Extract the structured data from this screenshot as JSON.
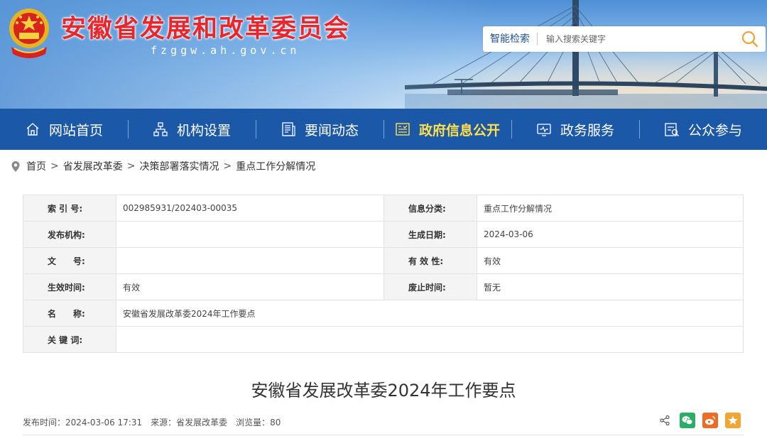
{
  "header": {
    "site_title": "安徽省发展和改革委员会",
    "site_domain": "fzggw.ah.gov.cn",
    "search": {
      "label": "智能检索",
      "placeholder": "输入搜索关键字"
    }
  },
  "nav": {
    "items": [
      {
        "label": "网站首页",
        "icon": "home-icon"
      },
      {
        "label": "机构设置",
        "icon": "org-chart-icon"
      },
      {
        "label": "要闻动态",
        "icon": "news-icon"
      },
      {
        "label": "政府信息公开",
        "icon": "info-disclosure-icon",
        "active": true
      },
      {
        "label": "政务服务",
        "icon": "service-monitor-icon"
      },
      {
        "label": "公众参与",
        "icon": "participation-icon"
      }
    ],
    "active_color": "#ffe04a",
    "bar_color": "#1c58a8"
  },
  "breadcrumb": {
    "icon": "location-pin-icon",
    "separator": ">",
    "items": [
      "首页",
      "省发展改革委",
      "决策部署落实情况",
      "重点工作分解情况"
    ]
  },
  "info": {
    "index_no_label": "索 引 号:",
    "index_no": "002985931/202403-00035",
    "category_label": "信息分类:",
    "category": "重点工作分解情况",
    "publisher_label": "发布机构:",
    "publisher": "",
    "created_label": "生成日期:",
    "created": "2024-03-06",
    "doc_no_label": "文　　号:",
    "doc_no": "",
    "validity_label": "有 效 性:",
    "validity": "有效",
    "effective_label": "生效时间:",
    "effective": "有效",
    "abolish_label": "废止时间:",
    "abolish": "暂无",
    "name_label": "名　　称:",
    "name": "安徽省发展改革委2024年工作要点",
    "keywords_label": "关 键 词:",
    "keywords": ""
  },
  "article": {
    "title": "安徽省发展改革委2024年工作要点",
    "publish_time": "发布时间：2024-03-06 17:31",
    "source": "来源：省发展改革委",
    "views": "浏览量：80"
  },
  "share": {
    "items": [
      {
        "icon": "share-icon"
      },
      {
        "icon": "wechat-icon",
        "color": "#2aae67"
      },
      {
        "icon": "weibo-icon",
        "color": "#ef6c28"
      },
      {
        "icon": "favorite-star-icon",
        "color": "#f2a531"
      }
    ]
  }
}
